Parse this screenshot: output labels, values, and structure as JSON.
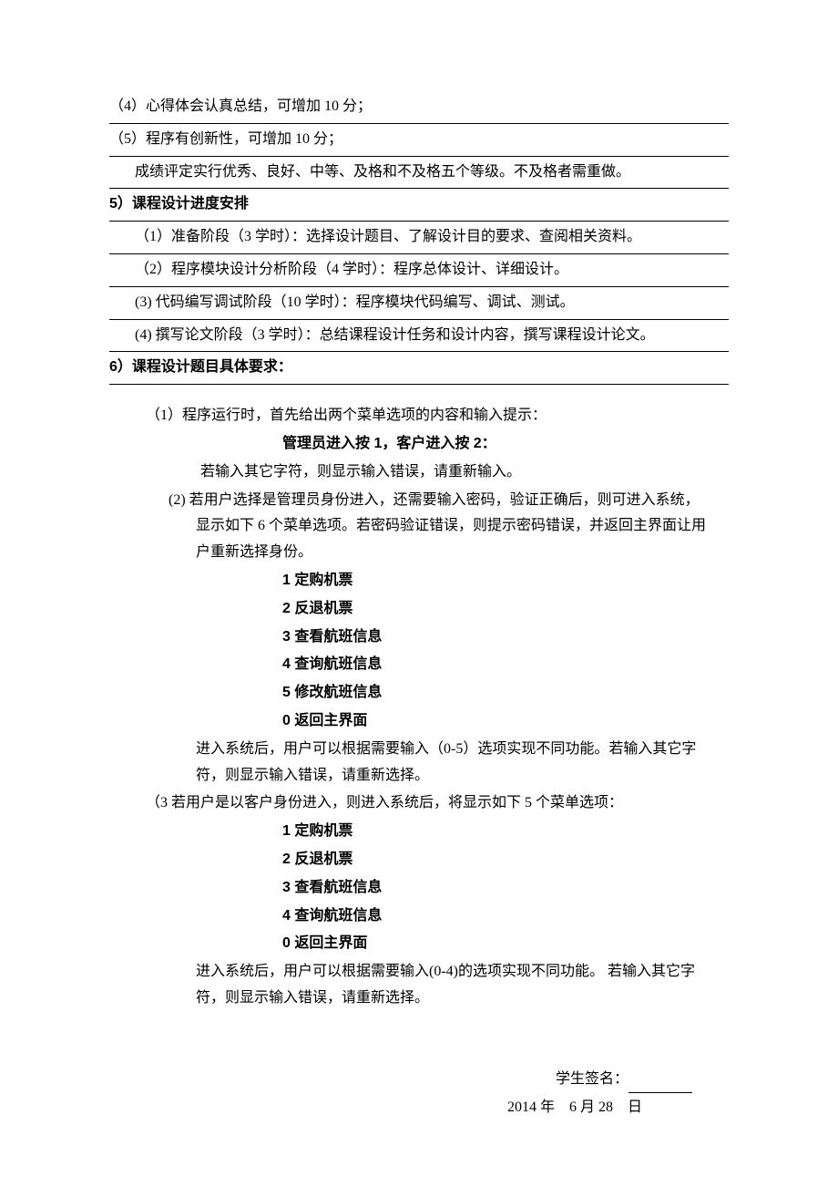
{
  "top_items": [
    "（4）心得体会认真总结，可增加 10 分；",
    "（5）程序有创新性，可增加 10 分；"
  ],
  "grade_note": "成绩评定实行优秀、良好、中等、及格和不及格五个等级。不及格者需重做。",
  "section5": {
    "title": "5）课程设计进度安排",
    "items": [
      "（1）准备阶段（3 学时）：选择设计题目、了解设计目的要求、查阅相关资料。",
      "（2）程序模块设计分析阶段（4 学时）：程序总体设计、详细设计。",
      "(3) 代码编写调试阶段（10 学时）：程序模块代码编写、调试、测试。",
      "(4) 撰写论文阶段（3 学时）：总结课程设计任务和设计内容，撰写课程设计论文。"
    ]
  },
  "section6": {
    "title": "6）课程设计题目具体要求：",
    "req1": {
      "head": "（1）程序运行时，首先给出两个菜单选项的内容和输入提示：",
      "bold_line": "管理员进入按 1，客户进入按 2：",
      "tail": "若输入其它字符，则显示输入错误，请重新输入。"
    },
    "req2": {
      "head": "(2) 若用户选择是管理员身份进入，还需要输入密码，验证正确后，则可进入系统，显示如下 6 个菜单选项。若密码验证错误，则提示密码错误，并返回主界面让用户重新选择身份。",
      "menu": [
        "1 定购机票",
        "2 反退机票",
        "3 查看航班信息",
        "4 查询航班信息",
        "5 修改航班信息",
        "0 返回主界面"
      ],
      "tail": "进入系统后，用户可以根据需要输入（0-5）选项实现不同功能。若输入其它字符，则显示输入错误，请重新选择。"
    },
    "req3": {
      "head": "（3 若用户是以客户身份进入，则进入系统后，将显示如下 5 个菜单选项：",
      "menu": [
        "1 定购机票",
        "2 反退机票",
        "3 查看航班信息",
        "4 查询航班信息",
        "0 返回主界面"
      ],
      "tail": "进入系统后，用户可以根据需要输入(0-4)的选项实现不同功能。 若输入其它字符，则显示输入错误，请重新选择。"
    }
  },
  "signature": {
    "label": "学生签名：",
    "date": "2014 年　6 月 28　日"
  }
}
